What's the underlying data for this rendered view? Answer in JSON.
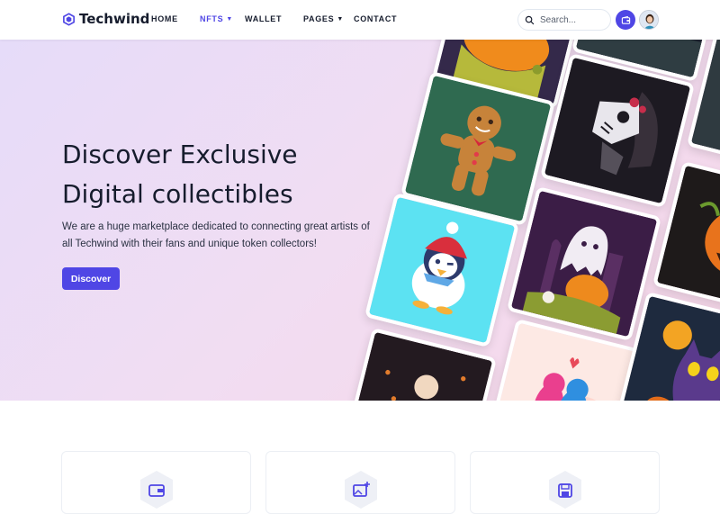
{
  "brand": {
    "name": "Techwind",
    "accent": "#4f46e5",
    "text": "#161c2d"
  },
  "nav": {
    "items": [
      {
        "label": "HOME",
        "active": false,
        "has_dropdown": false
      },
      {
        "label": "NFTS",
        "active": true,
        "has_dropdown": true
      },
      {
        "label": "WALLET",
        "active": false,
        "has_dropdown": false
      },
      {
        "label": "PAGES",
        "active": false,
        "has_dropdown": true
      },
      {
        "label": "CONTACT",
        "active": false,
        "has_dropdown": false
      }
    ],
    "search_placeholder": "Search...",
    "icons": {
      "search": "search-icon",
      "wallet": "wallet-icon",
      "avatar": "user-avatar"
    }
  },
  "hero": {
    "title_line1": "Discover Exclusive",
    "title_line2": "Digital collectibles",
    "description": "We are a huge marketplace dedicated to connecting great artists of all Techwind with their fans and unique token collectors!",
    "cta_label": "Discover"
  },
  "gallery": {
    "cards": [
      "pumpkin-artwork",
      "dark-artwork",
      "gingerbread-man-artwork",
      "skeleton-horse-artwork",
      "dark-scene-artwork",
      "penguin-artwork",
      "ghost-pumpkin-artwork",
      "jack-o-lantern-artwork",
      "night-moon-artwork",
      "parrots-artwork",
      "black-cat-artwork"
    ]
  },
  "features": {
    "icons": [
      "wallet-icon",
      "image-add-icon",
      "save-icon"
    ]
  }
}
